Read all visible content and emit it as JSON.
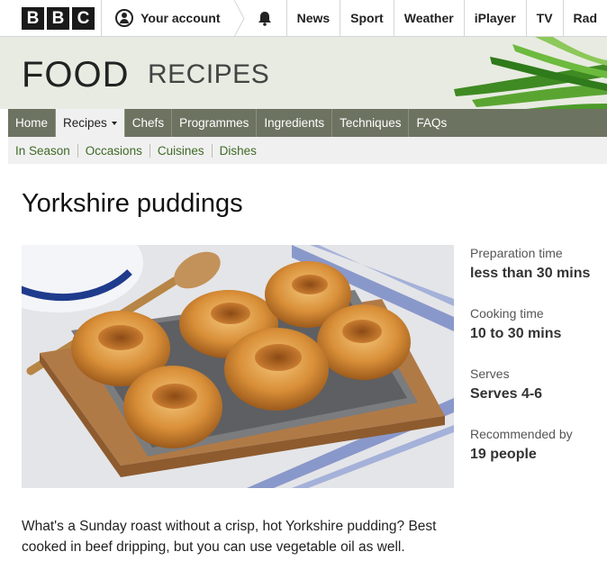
{
  "bbc": {
    "logo_letters": [
      "B",
      "B",
      "C"
    ]
  },
  "topbar": {
    "account_label": "Your account",
    "nav": [
      "News",
      "Sport",
      "Weather",
      "iPlayer",
      "TV",
      "Rad"
    ]
  },
  "header": {
    "title": "FOOD",
    "subtitle": "RECIPES"
  },
  "main_nav": {
    "items": [
      "Home",
      "Recipes",
      "Chefs",
      "Programmes",
      "Ingredients",
      "Techniques",
      "FAQs"
    ]
  },
  "sub_nav": {
    "items": [
      "In Season",
      "Occasions",
      "Cuisines",
      "Dishes"
    ]
  },
  "recipe": {
    "title": "Yorkshire puddings",
    "facts": [
      {
        "label": "Preparation time",
        "value": "less than 30 mins"
      },
      {
        "label": "Cooking time",
        "value": "10 to 30 mins"
      },
      {
        "label": "Serves",
        "value": "Serves 4-6"
      },
      {
        "label": "Recommended by",
        "value": "19 people"
      }
    ],
    "description": "What's a Sunday roast without a crisp, hot Yorkshire pudding? Best cooked in beef dripping, but you can use vegetable oil as well."
  },
  "colors": {
    "nav_bg": "#6d7361",
    "header_bg": "#e8ebe1",
    "sub_nav_link": "#3f6a26"
  },
  "icons": [
    "user-icon",
    "bell-icon"
  ]
}
